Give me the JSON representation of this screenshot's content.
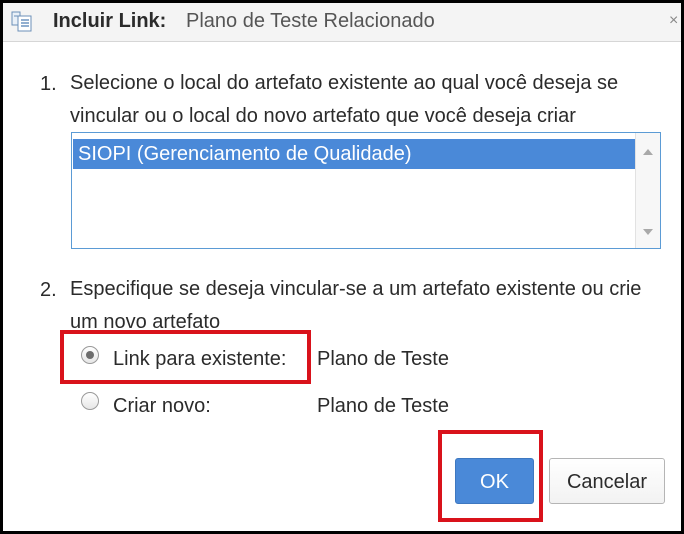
{
  "dialog": {
    "title_bold": "Incluir Link:",
    "title_rest": "Plano de Teste Relacionado"
  },
  "step1": {
    "number": "1.",
    "text": "Selecione o local do artefato existente ao qual você deseja se vincular ou o local do novo artefato que você deseja criar",
    "list_items": [
      "SIOPI (Gerenciamento de Qualidade)"
    ]
  },
  "step2": {
    "number": "2.",
    "text": "Especifique se deseja vincular-se a um artefato existente ou crie um novo artefato",
    "options": [
      {
        "label": "Link para existente:",
        "value": "Plano de Teste",
        "selected": true
      },
      {
        "label": "Criar novo:",
        "value": "Plano de Teste",
        "selected": false
      }
    ]
  },
  "buttons": {
    "ok": "OK",
    "cancel": "Cancelar"
  },
  "colors": {
    "accent": "#4a89d8",
    "highlight": "#d9121b"
  },
  "icons": {
    "title": "link-dialog-icon",
    "close": "close-icon"
  }
}
